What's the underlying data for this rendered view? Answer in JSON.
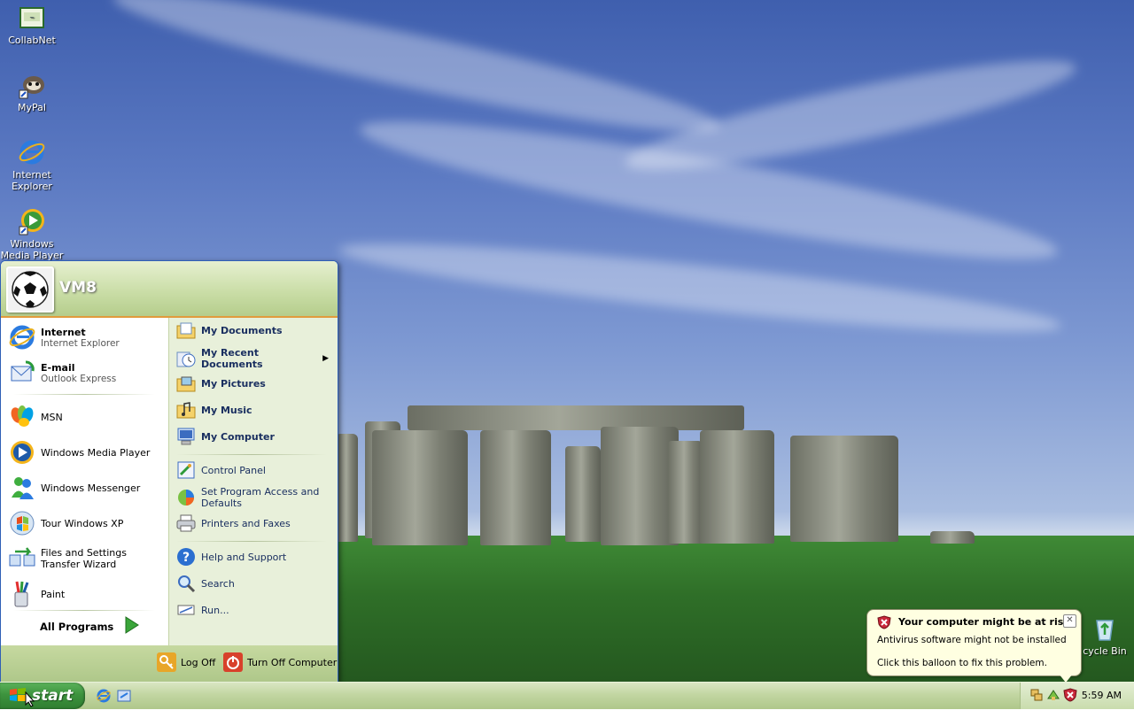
{
  "desktop": {
    "icons": [
      {
        "label": "CollabNet",
        "icon": "collabnet-icon"
      },
      {
        "label": "MyPal",
        "icon": "mypal-raccoon-icon"
      },
      {
        "label": "Internet Explorer",
        "icon": "internet-explorer-icon"
      },
      {
        "label": "Windows Media Player",
        "icon": "windows-media-player-icon"
      },
      {
        "label": "cycle Bin",
        "icon": "recycle-bin-icon"
      }
    ]
  },
  "start_menu": {
    "user_name": "VM8",
    "pinned": [
      {
        "title": "Internet",
        "subtitle": "Internet Explorer"
      },
      {
        "title": "E-mail",
        "subtitle": "Outlook Express"
      }
    ],
    "recent": [
      {
        "label": "MSN"
      },
      {
        "label": "Windows Media Player"
      },
      {
        "label": "Windows Messenger"
      },
      {
        "label": "Tour Windows XP"
      },
      {
        "label": "Files and Settings Transfer Wizard"
      },
      {
        "label": "Paint"
      }
    ],
    "all_programs": "All Programs",
    "places": [
      {
        "label": "My Documents"
      },
      {
        "label": "My Recent Documents"
      },
      {
        "label": "My Pictures"
      },
      {
        "label": "My Music"
      },
      {
        "label": "My Computer"
      }
    ],
    "settings": [
      {
        "label": "Control Panel"
      },
      {
        "label": "Set Program Access and Defaults"
      },
      {
        "label": "Printers and Faxes"
      }
    ],
    "tools": [
      {
        "label": "Help and Support"
      },
      {
        "label": "Search"
      },
      {
        "label": "Run..."
      }
    ],
    "footer": {
      "log_off": "Log Off",
      "turn_off": "Turn Off Computer"
    }
  },
  "taskbar": {
    "start_label": "start",
    "clock": "5:59 AM"
  },
  "balloon": {
    "title": "Your computer might be at risk",
    "line1": "Antivirus software might not be installed",
    "line2": "Click this balloon to fix this problem."
  },
  "colors": {
    "start_green": "#3d933e",
    "taskbar_olive": "#c2d6a2",
    "menu_border": "#2f5fb6",
    "balloon_bg": "#ffffe1"
  }
}
